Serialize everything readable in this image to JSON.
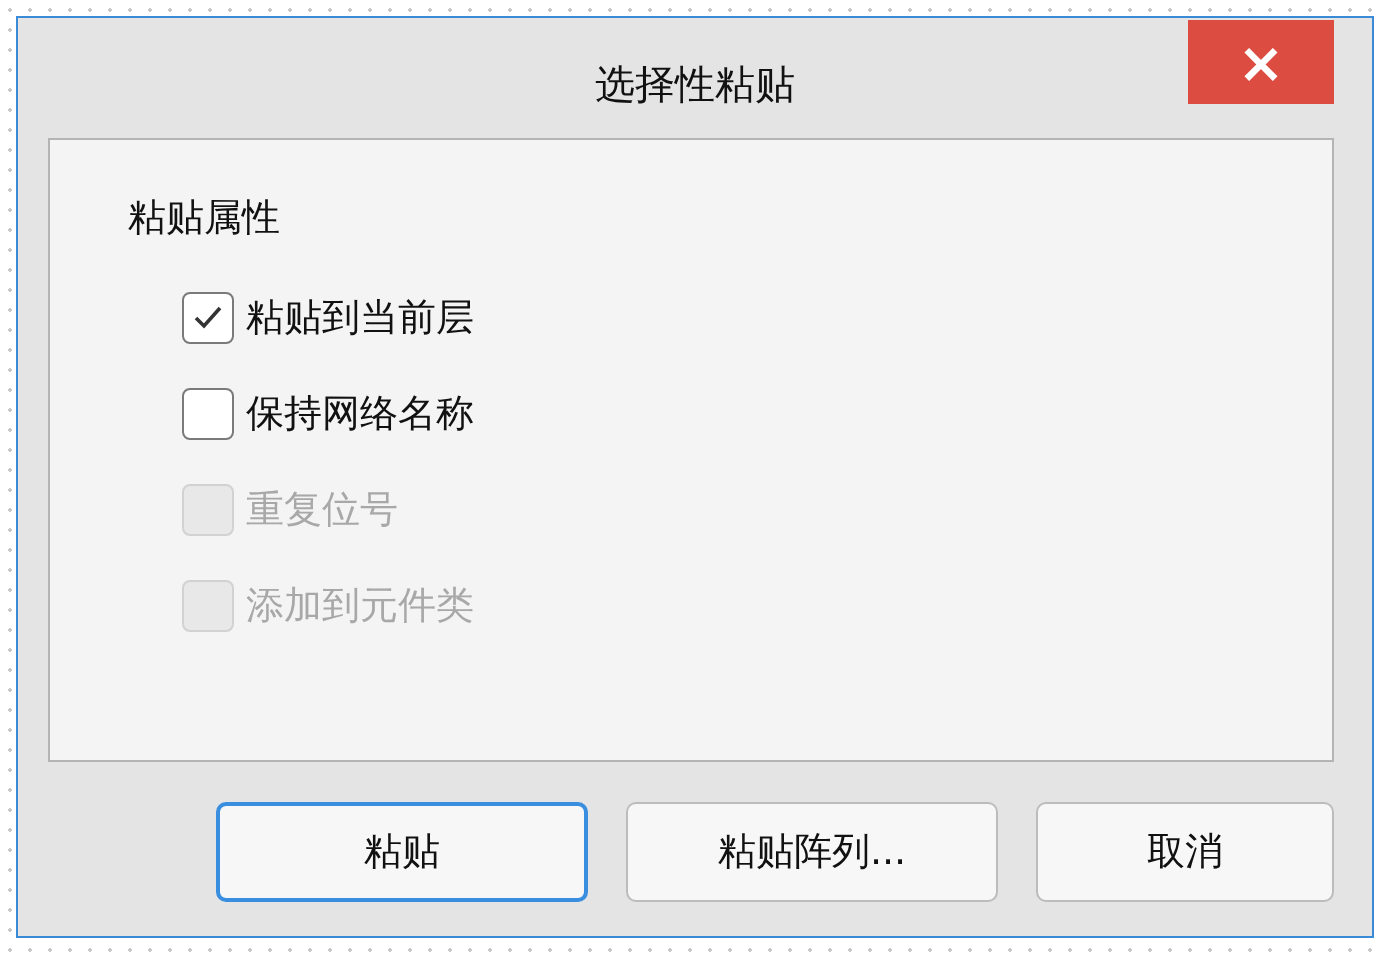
{
  "window": {
    "title": "选择性粘贴",
    "close": "×"
  },
  "group": {
    "title": "粘贴属性",
    "options": [
      {
        "label": "粘贴到当前层",
        "checked": true,
        "disabled": false
      },
      {
        "label": "保持网络名称",
        "checked": false,
        "disabled": false
      },
      {
        "label": "重复位号",
        "checked": false,
        "disabled": true
      },
      {
        "label": "添加到元件类",
        "checked": false,
        "disabled": true
      }
    ]
  },
  "buttons": [
    {
      "label": "粘贴",
      "default": true
    },
    {
      "label": "粘贴阵列...",
      "default": false
    },
    {
      "label": "取消",
      "default": false
    }
  ]
}
